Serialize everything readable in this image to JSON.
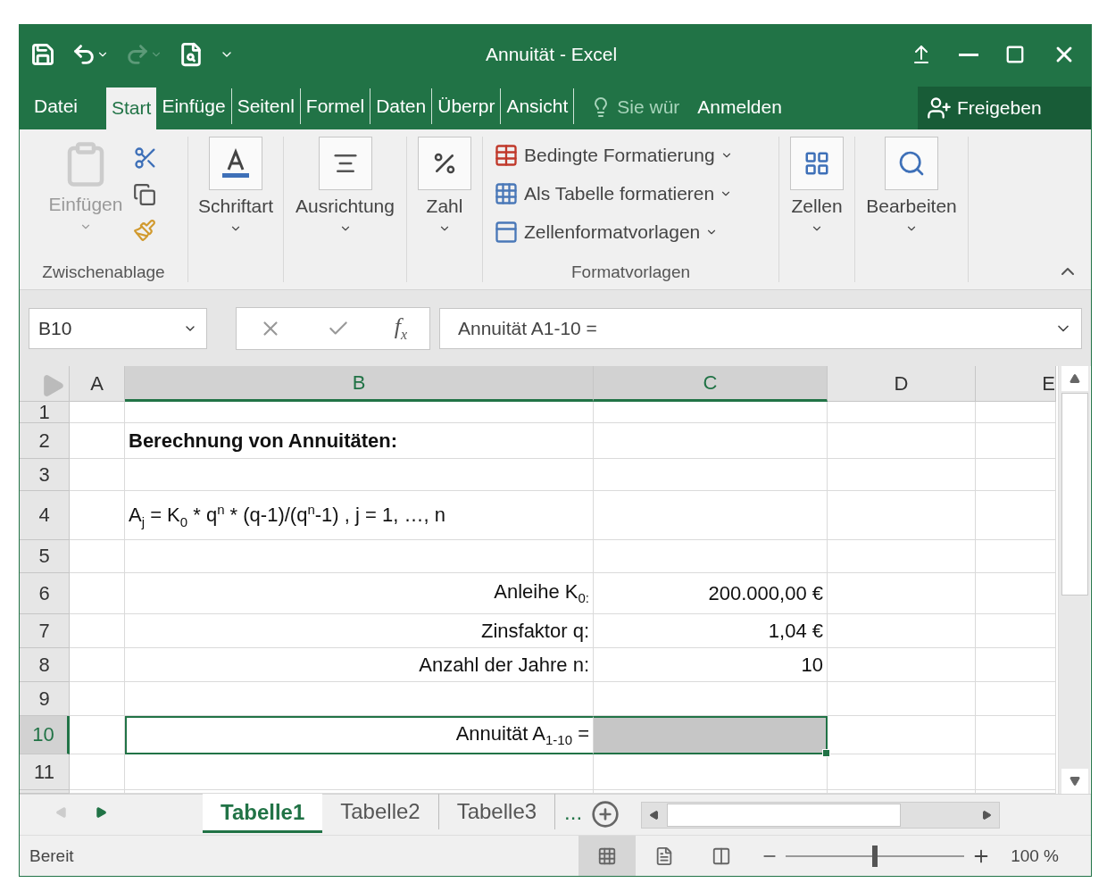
{
  "window": {
    "title": "Annuität - Excel",
    "quick_access": [
      {
        "kind": "save",
        "disabled": false
      },
      {
        "kind": "undo",
        "disabled": false
      },
      {
        "kind": "redo",
        "disabled": true
      },
      {
        "kind": "preview",
        "disabled": false
      }
    ]
  },
  "tabs": [
    {
      "label": "Datei",
      "selected": false
    },
    {
      "label": "Start",
      "selected": true
    },
    {
      "label": "Einfüge",
      "selected": false
    },
    {
      "label": "Seitenl",
      "selected": false
    },
    {
      "label": "Formel",
      "selected": false
    },
    {
      "label": "Daten",
      "selected": false
    },
    {
      "label": "Überpr",
      "selected": false
    },
    {
      "label": "Ansicht",
      "selected": false
    }
  ],
  "tell_me": {
    "placeholder": "Sie wür"
  },
  "sign_in": "Anmelden",
  "share": "Freigeben",
  "ribbon": {
    "clipboard": {
      "paste": "Einfügen",
      "paste_disabled": true,
      "group": "Zwischenablage"
    },
    "big_buttons": [
      {
        "kind": "font",
        "label": "Schriftart"
      },
      {
        "kind": "align",
        "label": "Ausrichtung"
      },
      {
        "kind": "number",
        "label": "Zahl"
      }
    ],
    "styles": {
      "items": [
        {
          "kind": "conditional",
          "label": "Bedingte Formatierung"
        },
        {
          "kind": "table",
          "label": "Als Tabelle formatieren"
        },
        {
          "kind": "cellstyles",
          "label": "Zellenformatvorlagen"
        }
      ],
      "group": "Formatvorlagen"
    },
    "end_buttons": [
      {
        "kind": "cells",
        "label": "Zellen"
      },
      {
        "kind": "edit",
        "label": "Bearbeiten"
      }
    ]
  },
  "name_box": "B10",
  "function_button": "f$_{x}$",
  "formula": "Annuität A1-10 =",
  "columns": [
    {
      "label": "A",
      "selected": false
    },
    {
      "label": "B",
      "selected": true
    },
    {
      "label": "C",
      "selected": true
    },
    {
      "label": "D",
      "selected": false
    },
    {
      "label": "E",
      "selected": false
    }
  ],
  "rows": [
    {
      "label": "1",
      "selected": false
    },
    {
      "label": "2",
      "selected": false,
      "column_b": {
        "kind": "heading",
        "text": "Berechnung von Annuitäten:"
      }
    },
    {
      "label": "3",
      "selected": false
    },
    {
      "label": "4",
      "selected": false,
      "column_b": {
        "kind": "formula",
        "text": "A$_{j}$ = K$_{0}$ * q$^{n}$ * (q-1)/(q$^{n}$-1) ,  j = 1, …, n"
      }
    },
    {
      "label": "5",
      "selected": false
    },
    {
      "label": "6",
      "selected": false,
      "column_b": {
        "kind": "label",
        "text": "Anleihe K$_{0:}$"
      },
      "column_c": {
        "kind": "value",
        "text": "200.000,00 €"
      }
    },
    {
      "label": "7",
      "selected": false,
      "column_b": {
        "kind": "label",
        "text": "Zinsfaktor q:"
      },
      "column_c": {
        "kind": "value",
        "text": "1,04 €"
      }
    },
    {
      "label": "8",
      "selected": false,
      "column_b": {
        "kind": "label",
        "text": "Anzahl der Jahre n:"
      },
      "column_c": {
        "kind": "value",
        "text": "10"
      }
    },
    {
      "label": "9",
      "selected": false
    },
    {
      "label": "10",
      "selected": true,
      "column_b": {
        "kind": "label",
        "text": "Annuität A$_{1-10}$ ="
      },
      "column_c": {
        "kind": "highlight"
      }
    },
    {
      "label": "11",
      "selected": false
    }
  ],
  "sheets": [
    {
      "label": "Tabelle1",
      "selected": true
    },
    {
      "label": "Tabelle2",
      "selected": false
    },
    {
      "label": "Tabelle3",
      "selected": false
    }
  ],
  "more_sheets": "...",
  "status_bar": {
    "text": "Bereit",
    "views": [
      {
        "kind": "normal",
        "selected": true
      },
      {
        "kind": "layout",
        "selected": false
      },
      {
        "kind": "pagebreak",
        "selected": false
      }
    ],
    "zoom": {
      "level": 0.5,
      "reading": "100 %"
    }
  }
}
